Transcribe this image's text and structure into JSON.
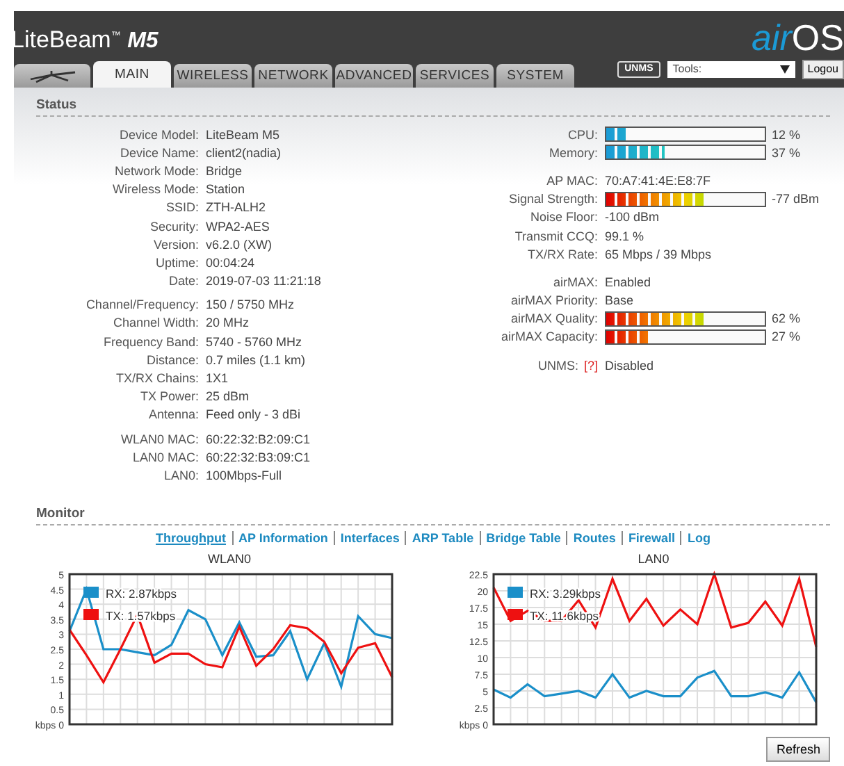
{
  "header": {
    "product": "LiteBeam",
    "trademark": "™",
    "model": "M5",
    "brand_prefix": "air",
    "brand_suffix": "OS"
  },
  "tabs": [
    {
      "kind": "icon",
      "selected": false
    },
    {
      "kind": "text",
      "label": "MAIN",
      "selected": true
    },
    {
      "kind": "text",
      "label": "WIRELESS",
      "selected": false
    },
    {
      "kind": "text",
      "label": "NETWORK",
      "selected": false
    },
    {
      "kind": "text",
      "label": "ADVANCED",
      "selected": false
    },
    {
      "kind": "text",
      "label": "SERVICES",
      "selected": false
    },
    {
      "kind": "text",
      "label": "SYSTEM",
      "selected": false
    }
  ],
  "unms_button": "UNMS",
  "tools": {
    "value": "Tools:"
  },
  "logout_button": "Logou",
  "status": {
    "title": "Status",
    "left_groups": [
      [
        {
          "label": "Device Model:",
          "value": "LiteBeam M5"
        },
        {
          "label": "Device Name:",
          "value": "client2(nadia)"
        },
        {
          "label": "Network Mode:",
          "value": "Bridge"
        },
        {
          "label": "Wireless Mode:",
          "value": "Station"
        },
        {
          "label": "SSID:",
          "value": "ZTH-ALH2"
        },
        {
          "label": "Security:",
          "value": "WPA2-AES"
        },
        {
          "label": "Version:",
          "value": "v6.2.0 (XW)"
        },
        {
          "label": "Uptime:",
          "value": "00:04:24"
        },
        {
          "label": "Date:",
          "value": "2019-07-03 11:21:18"
        }
      ],
      [
        {
          "label": "Channel/Frequency:",
          "value": "150 / 5750 MHz"
        },
        {
          "label": "Channel Width:",
          "value": "20 MHz"
        },
        {
          "label": "Frequency Band:",
          "value": "5740 - 5760 MHz"
        },
        {
          "label": "Distance:",
          "value": "0.7 miles (1.1 km)"
        },
        {
          "label": "TX/RX Chains:",
          "value": "1X1"
        },
        {
          "label": "TX Power:",
          "value": "25 dBm"
        },
        {
          "label": "Antenna:",
          "value": "Feed only - 3 dBi"
        }
      ],
      [
        {
          "label": "WLAN0 MAC:",
          "value": "60:22:32:B2:09:C1"
        },
        {
          "label": "LAN0 MAC:",
          "value": "60:22:32:B3:09:C1"
        },
        {
          "label": "LAN0:",
          "value": "100Mbps-Full"
        }
      ]
    ],
    "right_groups": [
      [
        {
          "kind": "usage_meter",
          "label": "CPU:",
          "level": 0.12,
          "reading": "12 %"
        },
        {
          "kind": "usage_meter",
          "label": "Memory:",
          "level": 0.37,
          "reading": "37 %"
        }
      ],
      [
        {
          "kind": "text",
          "label": "AP MAC:",
          "value": "70:A7:41:4E:E8:7F"
        },
        {
          "kind": "signal_meter",
          "label": "Signal Strength:",
          "level": 0.63,
          "reading": "-77 dBm"
        },
        {
          "kind": "text",
          "label": "Noise Floor:",
          "value": "-100 dBm"
        },
        {
          "kind": "text",
          "label": "Transmit CCQ:",
          "value": "99.1 %"
        },
        {
          "kind": "text",
          "label": "TX/RX Rate:",
          "value": "65 Mbps / 39 Mbps"
        }
      ],
      [
        {
          "kind": "text",
          "label": "airMAX:",
          "value": "Enabled"
        },
        {
          "kind": "text",
          "label": "airMAX Priority:",
          "value": "Base"
        },
        {
          "kind": "signal_meter",
          "label": "airMAX Quality:",
          "level": 0.62,
          "reading": "62 %"
        },
        {
          "kind": "signal_meter",
          "label": "airMAX Capacity:",
          "level": 0.27,
          "reading": "27 %"
        }
      ],
      [
        {
          "kind": "help",
          "label": "UNMS:",
          "help": "[?]",
          "value": "Disabled"
        }
      ]
    ]
  },
  "monitor": {
    "title": "Monitor",
    "links": [
      {
        "label": "Throughput",
        "selected": true
      },
      {
        "label": "AP Information",
        "selected": false
      },
      {
        "label": "Interfaces",
        "selected": false
      },
      {
        "label": "ARP Table",
        "selected": false
      },
      {
        "label": "Bridge Table",
        "selected": false
      },
      {
        "label": "Routes",
        "selected": false
      },
      {
        "label": "Firewall",
        "selected": false
      },
      {
        "label": "Log",
        "selected": false
      }
    ],
    "charts": [
      {
        "chart_data": {
          "type": "line",
          "title": "WLAN0",
          "grid": true,
          "legend": true,
          "ylim": [
            0,
            5
          ],
          "yticks": [
            {
              "value": 0,
              "label": "kbps 0"
            },
            0.5,
            1,
            1.5,
            2,
            2.5,
            3,
            3.5,
            4,
            4.5,
            5
          ],
          "series": [
            {
              "name": "RX: 2.87kbps",
              "color": "#1a8fc9",
              "values": [
                3.1,
                4.5,
                2.5,
                2.5,
                2.4,
                2.3,
                2.65,
                3.8,
                3.5,
                2.3,
                3.4,
                2.25,
                2.3,
                3.1,
                1.5,
                2.7,
                1.25,
                3.6,
                3.0,
                2.87
              ]
            },
            {
              "name": "TX: 1.57kbps",
              "color": "#ee1111",
              "values": [
                3.15,
                2.3,
                1.4,
                2.5,
                3.65,
                2.05,
                2.35,
                2.35,
                2.0,
                1.9,
                3.25,
                1.95,
                2.5,
                3.3,
                3.2,
                2.75,
                1.7,
                2.55,
                2.7,
                1.57
              ]
            }
          ]
        }
      },
      {
        "chart_data": {
          "type": "line",
          "title": "LAN0",
          "grid": true,
          "legend": true,
          "ylim": [
            0,
            22.5
          ],
          "yticks": [
            {
              "value": 0,
              "label": "kbps 0"
            },
            2.5,
            5,
            7.5,
            10,
            12.5,
            15,
            17.5,
            20,
            22.5
          ],
          "series": [
            {
              "name": "RX: 3.29kbps",
              "color": "#1a8fc9",
              "values": [
                5.2,
                4,
                6,
                4.2,
                4.6,
                5,
                4,
                7.5,
                4,
                5,
                4.2,
                4.2,
                7,
                8,
                4.2,
                4.2,
                4.8,
                4,
                7.8,
                3.3
              ]
            },
            {
              "name": "TX: 11.6kbps",
              "color": "#ee1111",
              "values": [
                20.5,
                15.5,
                17,
                15.5,
                15.5,
                18.6,
                14.5,
                21.8,
                15.5,
                18.8,
                14.8,
                17.2,
                15,
                22.5,
                14.5,
                15.2,
                18.4,
                14.8,
                21.8,
                11.6
              ]
            }
          ]
        }
      }
    ],
    "refresh_button": "Refresh"
  }
}
